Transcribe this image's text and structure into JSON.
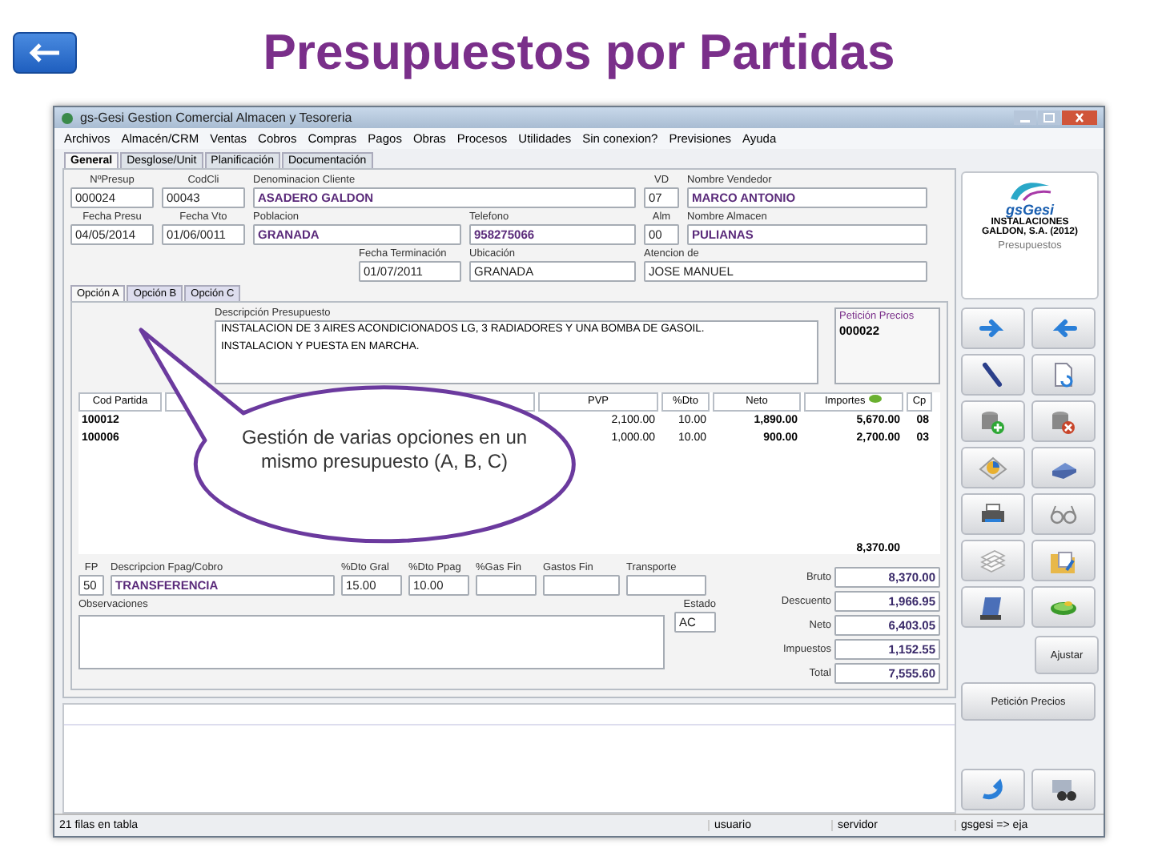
{
  "slide": {
    "title": "Presupuestos por Partidas"
  },
  "window": {
    "title": "gs-Gesi Gestion Comercial Almacen y Tesoreria"
  },
  "menu": [
    "Archivos",
    "Almacén/CRM",
    "Ventas",
    "Cobros",
    "Compras",
    "Pagos",
    "Obras",
    "Procesos",
    "Utilidades",
    "Sin conexion?",
    "Previsiones",
    "Ayuda"
  ],
  "tabs": [
    {
      "label": "General",
      "selected": true
    },
    {
      "label": "Desglose/Unit",
      "selected": false
    },
    {
      "label": "Planificación",
      "selected": false
    },
    {
      "label": "Documentación",
      "selected": false
    }
  ],
  "header": {
    "fields": [
      {
        "label": "NºPresup",
        "value": "000024",
        "highlighted": false
      },
      {
        "label": "CodCli",
        "value": "00043",
        "highlighted": false
      },
      {
        "label": "Denominacion Cliente",
        "value": "ASADERO GALDON",
        "highlighted": true
      },
      {
        "label": "VD",
        "value": "07",
        "highlighted": false
      },
      {
        "label": "Nombre Vendedor",
        "value": "MARCO ANTONIO",
        "highlighted": true
      },
      {
        "label": "Fecha Presu",
        "value": "04/05/2014",
        "highlighted": false
      },
      {
        "label": "Fecha Vto",
        "value": "01/06/0011",
        "highlighted": false
      },
      {
        "label": "Poblacion",
        "value": "GRANADA",
        "highlighted": true
      },
      {
        "label": "Telefono",
        "value": "958275066",
        "highlighted": true
      },
      {
        "label": "Alm",
        "value": "00",
        "highlighted": false
      },
      {
        "label": "Nombre Almacen",
        "value": "PULIANAS",
        "highlighted": true
      },
      {
        "label": "Fecha Terminación",
        "value": "01/07/2011",
        "highlighted": false
      },
      {
        "label": "Ubicación",
        "value": "GRANADA",
        "highlighted": false
      },
      {
        "label": "Atencion de",
        "value": "JOSE MANUEL",
        "highlighted": false
      }
    ]
  },
  "option_tabs": [
    {
      "label": "Opción A",
      "selected": true
    },
    {
      "label": "Opción B",
      "selected": false
    },
    {
      "label": "Opción C",
      "selected": false
    }
  ],
  "description": {
    "label": "Descripción Presupuesto",
    "lines": [
      "INSTALACION DE 3 AIRES ACONDICIONADOS LG, 3 RADIADORES Y UNA BOMBA DE GASOIL.",
      "INSTALACION Y PUESTA EN MARCHA."
    ]
  },
  "price_request": {
    "label": "Petición Precios",
    "value": "000022"
  },
  "table": {
    "columns": [
      "Cod Partida",
      "PVP",
      "%Dto",
      "Neto",
      "Importes",
      "Cp"
    ],
    "rows": [
      {
        "cells": [
          "100012",
          "2,100.00",
          "10.00",
          "1,890.00",
          "5,670.00",
          "08"
        ]
      },
      {
        "cells": [
          "100006",
          "1,000.00",
          "10.00",
          "900.00",
          "2,700.00",
          "03"
        ]
      }
    ],
    "total": "8,370.00"
  },
  "payment": [
    {
      "label": "FP",
      "value": "50",
      "highlighted": false
    },
    {
      "label": "Descripcion Fpag/Cobro",
      "value": "TRANSFERENCIA",
      "highlighted": true
    },
    {
      "label": "%Dto Gral",
      "value": "15.00",
      "highlighted": false
    },
    {
      "label": "%Dto Ppag",
      "value": "10.00",
      "highlighted": false
    },
    {
      "label": "%Gas Fin"
    },
    {
      "label": "Gastos Fin"
    },
    {
      "label": "Transporte"
    }
  ],
  "observations": {
    "label": "Observaciones"
  },
  "status_field": {
    "label": "Estado",
    "value": "AC"
  },
  "totals": [
    {
      "label": "Bruto",
      "value": "8,370.00"
    },
    {
      "label": "Descuento",
      "value": "1,966.95"
    },
    {
      "label": "Neto",
      "value": "6,403.05"
    },
    {
      "label": "Impuestos",
      "value": "1,152.55"
    },
    {
      "label": "Total",
      "value": "7,555.60"
    }
  ],
  "company": {
    "logo": "gsGesi",
    "name": "INSTALACIONES GALDON, S.A. (2012)",
    "module": "Presupuestos"
  },
  "side_buttons": [
    "Ajustar",
    "Petición Precios"
  ],
  "status_bar": [
    "21 filas en tabla",
    "usuario",
    "servidor",
    "gsgesi => eja"
  ],
  "callout": {
    "text": "Gestión de varias opciones en un mismo presupuesto (A, B, C)"
  }
}
